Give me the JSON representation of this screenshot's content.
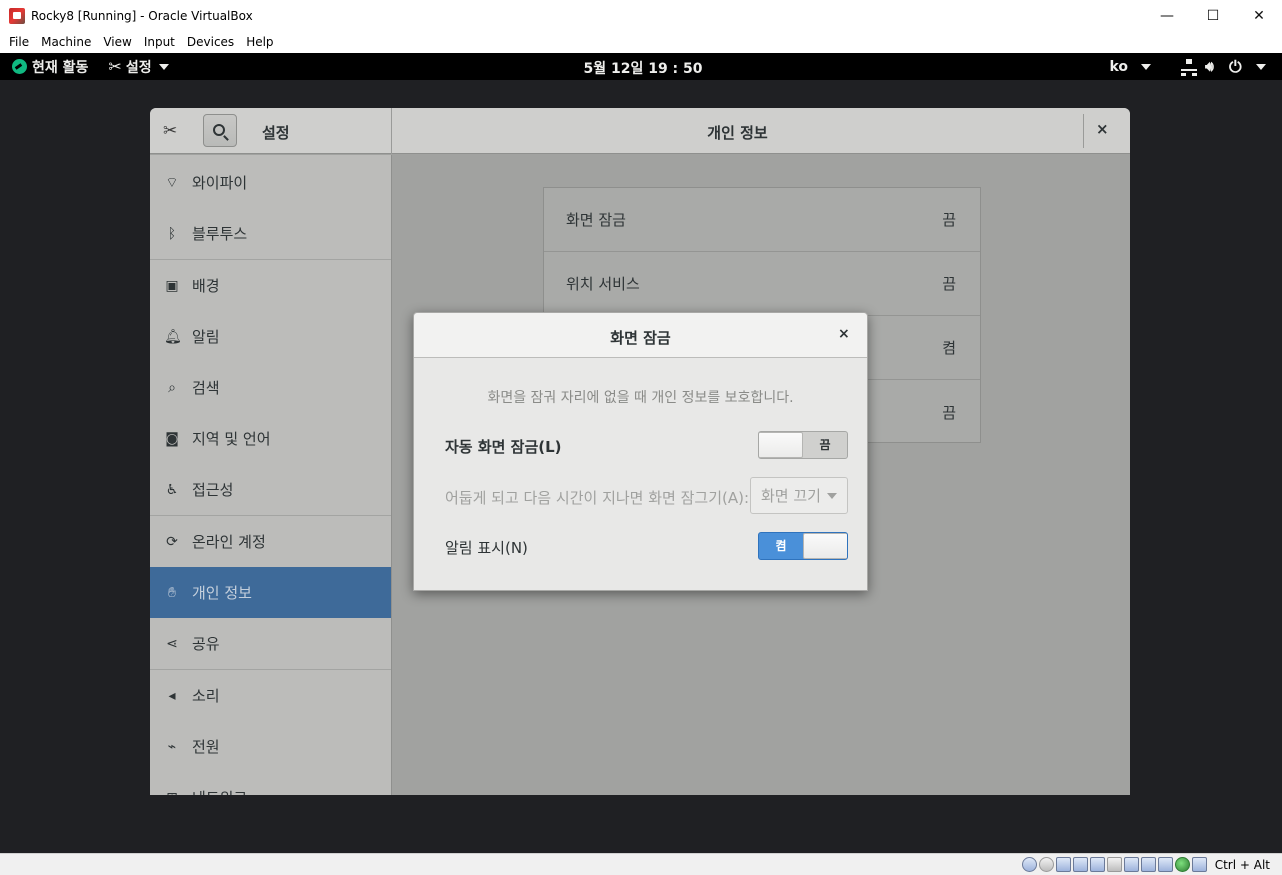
{
  "host": {
    "window_title": "Rocky8 [Running] - Oracle VirtualBox",
    "controls": {
      "minimize": "—",
      "maximize": "☐",
      "close": "✕"
    },
    "menu": [
      "File",
      "Machine",
      "View",
      "Input",
      "Devices",
      "Help"
    ],
    "status": {
      "hostkey": "Ctrl + Alt"
    }
  },
  "gnome": {
    "activities": "현재 활동",
    "app_menu": "설정",
    "clock": "5월 12일  19 : 50",
    "input_lang": "ko"
  },
  "settings": {
    "sidebar_title": "설정",
    "page_title": "개인 정보",
    "close": "×",
    "sidebar": [
      {
        "label": "와이파이",
        "icon": "wifi-icon",
        "glyph": "⌔"
      },
      {
        "label": "블루투스",
        "icon": "bluetooth-icon",
        "glyph": "ᛒ"
      },
      {
        "label": "배경",
        "icon": "background-icon",
        "glyph": "▣"
      },
      {
        "label": "알림",
        "icon": "bell-icon",
        "glyph": "🔔︎"
      },
      {
        "label": "검색",
        "icon": "search-icon",
        "glyph": "⌕"
      },
      {
        "label": "지역 및 언어",
        "icon": "camera-icon",
        "glyph": "◙"
      },
      {
        "label": "접근성",
        "icon": "accessibility-icon",
        "glyph": "♿︎"
      },
      {
        "label": "온라인 계정",
        "icon": "online-accounts-icon",
        "glyph": "⟳"
      },
      {
        "label": "개인 정보",
        "icon": "privacy-hand-icon",
        "glyph": "✋︎"
      },
      {
        "label": "공유",
        "icon": "share-icon",
        "glyph": "⋖"
      },
      {
        "label": "소리",
        "icon": "sound-icon",
        "glyph": "◂"
      },
      {
        "label": "전원",
        "icon": "power-plug-icon",
        "glyph": "⌁"
      },
      {
        "label": "네트워크",
        "icon": "network-icon",
        "glyph": "⊞"
      }
    ],
    "privacy_rows": [
      {
        "label": "화면 잠금",
        "value": "끔"
      },
      {
        "label": "위치 서비스",
        "value": "끔"
      },
      {
        "label": "",
        "value": "켬"
      },
      {
        "label": "",
        "value": "끔"
      }
    ]
  },
  "dialog": {
    "title": "화면 잠금",
    "close": "×",
    "description": "화면을 잠궈 자리에 없을 때 개인 정보를 보호합니다.",
    "auto_lock": {
      "label": "자동 화면 잠금(L)",
      "state": "끔"
    },
    "lock_after": {
      "label": "어둡게 되고 다음 시간이 지나면 화면 잠그기(A):",
      "value": "화면 끄기"
    },
    "notifications": {
      "label": "알림 표시(N)",
      "state": "켬"
    }
  }
}
